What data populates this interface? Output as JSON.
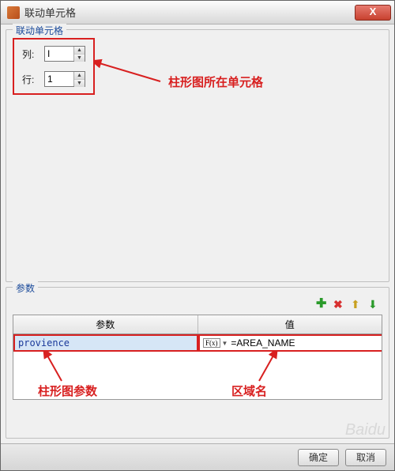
{
  "window": {
    "title": "联动单元格"
  },
  "cells_group": {
    "title": "联动单元格",
    "col_label": "列:",
    "col_value": "I",
    "row_label": "行:",
    "row_value": "1"
  },
  "params_group": {
    "title": "参数",
    "header_param": "参数",
    "header_value": "值",
    "row": {
      "name": "provience",
      "fx_label": "F(x)",
      "value": "=AREA_NAME"
    }
  },
  "annotations": {
    "cell_location": "柱形图所在单元格",
    "param_label": "柱形图参数",
    "region_label": "区域名"
  },
  "footer": {
    "ok": "确定",
    "cancel": "取消"
  },
  "watermark": "Baidu"
}
